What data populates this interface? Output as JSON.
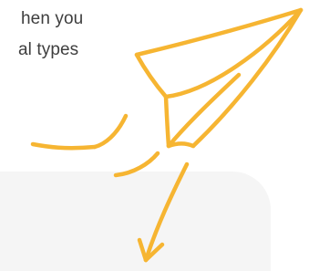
{
  "text_fragment": {
    "line_1": "hen you",
    "line_2": "al types"
  },
  "illustration": {
    "icon": "paper-plane-icon",
    "accent_color": "#f6b532",
    "card_color": "#f5f5f5"
  }
}
